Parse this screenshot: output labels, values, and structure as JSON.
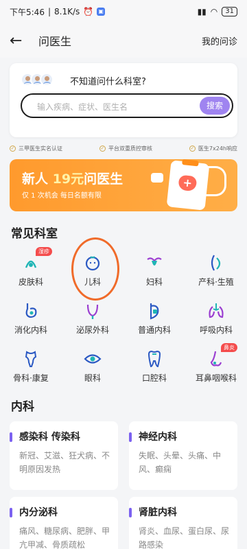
{
  "status_bar": {
    "time": "下午5:46",
    "speed": "8.1K/s",
    "battery": "31"
  },
  "nav": {
    "title": "问医生",
    "right": "我的问诊"
  },
  "ask": {
    "question": "不知道问什么科室?",
    "search_placeholder": "输入疾病、症状、医生名",
    "search_button": "搜索"
  },
  "guarantees": [
    "三甲医生实名认证",
    "平台双重质控审核",
    "医生7x24h响应"
  ],
  "banner": {
    "title_pre": "新人",
    "title_num": "19元",
    "title_post": "问医生",
    "subtitle": "仅 1 次机会  每日名额有限"
  },
  "common_title": "常见科室",
  "departments": [
    {
      "label": "皮肤科",
      "icon": "skin-icon",
      "badge": "湿疹"
    },
    {
      "label": "儿科",
      "icon": "baby-face-icon",
      "badge": ""
    },
    {
      "label": "妇科",
      "icon": "uterus-icon",
      "badge": ""
    },
    {
      "label": "产科·生殖",
      "icon": "pregnancy-icon",
      "badge": ""
    },
    {
      "label": "消化内科",
      "icon": "stomach-icon",
      "badge": ""
    },
    {
      "label": "泌尿外科",
      "icon": "bladder-icon",
      "badge": ""
    },
    {
      "label": "普通内科",
      "icon": "medicine-icon",
      "badge": ""
    },
    {
      "label": "呼吸内科",
      "icon": "lungs-icon",
      "badge": ""
    },
    {
      "label": "骨科·康复",
      "icon": "bone-icon",
      "badge": ""
    },
    {
      "label": "眼科",
      "icon": "eye-icon",
      "badge": ""
    },
    {
      "label": "口腔科",
      "icon": "tooth-icon",
      "badge": ""
    },
    {
      "label": "耳鼻咽喉科",
      "icon": "nose-icon",
      "badge": "鼻炎"
    }
  ],
  "internal_title": "内科",
  "internal": [
    {
      "name": "感染科 传染科",
      "desc": "新冠、艾滋、狂犬病、不明原因发热"
    },
    {
      "name": "神经内科",
      "desc": "失眠、头晕、头痛、中风、癫痫"
    },
    {
      "name": "内分泌科",
      "desc": "痛风、糖尿病、肥胖、甲亢甲减、骨质疏松"
    },
    {
      "name": "肾脏内科",
      "desc": "肾炎、血尿、蛋白尿、尿路感染"
    }
  ],
  "colors": {
    "accent": "#9f84f0",
    "banner": "#ff9a2d",
    "badge": "#f44c4c",
    "highlight_circle": "#f06b2a"
  }
}
